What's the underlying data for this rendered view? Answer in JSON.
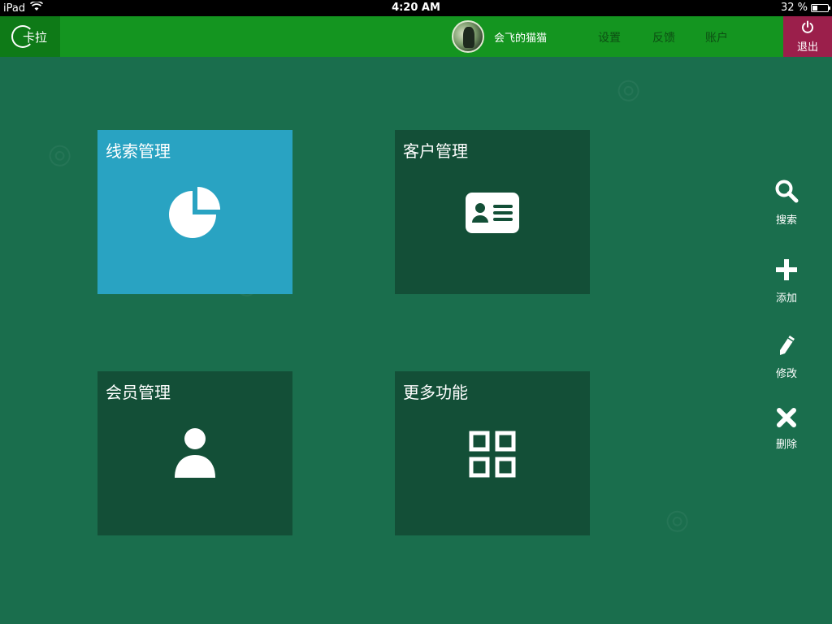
{
  "status_bar": {
    "device": "iPad",
    "time": "4:20 AM",
    "battery": "32 %",
    "battery_level": 0.32
  },
  "top_nav": {
    "logo_text": "卡拉",
    "user_name": "会飞的猫猫",
    "links": [
      "设置",
      "反馈",
      "账户"
    ],
    "exit_label": "退出"
  },
  "tiles": [
    {
      "title": "线索管理",
      "icon": "pie-chart-icon",
      "active": true
    },
    {
      "title": "客户管理",
      "icon": "id-card-icon",
      "active": false
    },
    {
      "title": "会员管理",
      "icon": "user-icon",
      "active": false
    },
    {
      "title": "更多功能",
      "icon": "grid-icon",
      "active": false
    }
  ],
  "side_actions": [
    {
      "label": "搜索",
      "icon": "search-icon"
    },
    {
      "label": "添加",
      "icon": "plus-icon"
    },
    {
      "label": "修改",
      "icon": "pencil-icon"
    },
    {
      "label": "删除",
      "icon": "close-icon"
    }
  ],
  "colors": {
    "background": "#1a6e4d",
    "nav": "#149520",
    "logo_bg": "#0e7a17",
    "exit_bg": "#9b1f4b",
    "tile": "#134f37",
    "tile_active": "#29a3c2"
  }
}
